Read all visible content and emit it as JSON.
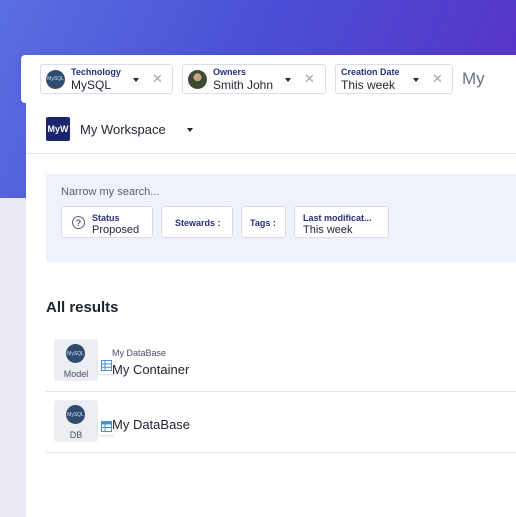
{
  "filters": [
    {
      "label": "Technology",
      "value": "MySQL",
      "avatar": "MySQL"
    },
    {
      "label": "Owners",
      "value": "Smith John"
    },
    {
      "label": "Creation Date",
      "value": "This week"
    }
  ],
  "filter_more": "My",
  "workspace": {
    "logo": "MyW",
    "name": "My Workspace"
  },
  "narrow": {
    "title": "Narrow my search...",
    "status": {
      "label": "Status",
      "value": "Proposed"
    },
    "stewards": {
      "label": "Stewards :"
    },
    "tags": {
      "label": "Tags :"
    },
    "last_modified": {
      "label": "Last modificat...",
      "value": "This week"
    }
  },
  "results": {
    "title": "All results",
    "items": [
      {
        "type": "Model",
        "parent": "My DataBase",
        "name": "My Container",
        "icon": "table-icon"
      },
      {
        "type": "DB",
        "name": "My DataBase",
        "icon": "database-table-icon"
      }
    ]
  },
  "colors": {
    "accent": "#2a2f7a",
    "brand": "#1c2670",
    "header_gradient_start": "#5a6fe0",
    "header_gradient_end": "#5a2fc6"
  }
}
